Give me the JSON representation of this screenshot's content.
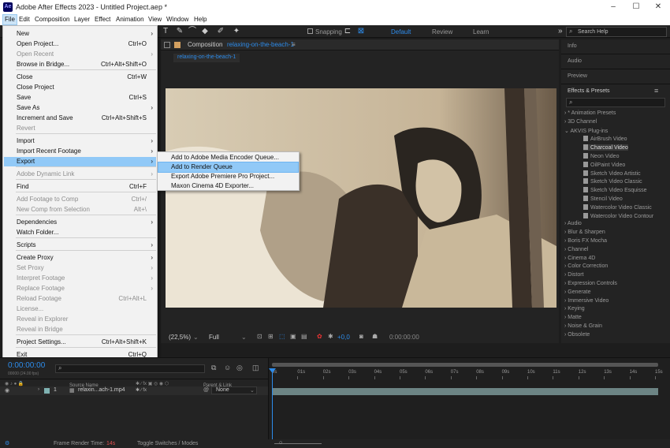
{
  "window": {
    "title": "Adobe After Effects 2023 - Untitled Project.aep *",
    "logo": "Ae",
    "minimize": "–",
    "maximize": "☐",
    "close": "✕"
  },
  "menubar": [
    "File",
    "Edit",
    "Composition",
    "Layer",
    "Effect",
    "Animation",
    "View",
    "Window",
    "Help"
  ],
  "toolbar": {
    "snapping": "Snapping",
    "workspaces": [
      "Default",
      "Review",
      "Learn"
    ],
    "more": "»",
    "search_placeholder": "Search Help"
  },
  "file_menu": [
    {
      "label": "New",
      "submenu": true
    },
    {
      "label": "Open Project...",
      "shortcut": "Ctrl+O"
    },
    {
      "label": "Open Recent",
      "disabled": true,
      "submenu": true
    },
    {
      "label": "Browse in Bridge...",
      "shortcut": "Ctrl+Alt+Shift+O"
    },
    {
      "label": "Close",
      "shortcut": "Ctrl+W"
    },
    {
      "label": "Close Project"
    },
    {
      "label": "Save",
      "shortcut": "Ctrl+S"
    },
    {
      "label": "Save As",
      "submenu": true
    },
    {
      "label": "Increment and Save",
      "shortcut": "Ctrl+Alt+Shift+S"
    },
    {
      "label": "Revert",
      "disabled": true
    },
    {
      "label": "Import",
      "submenu": true
    },
    {
      "label": "Import Recent Footage",
      "submenu": true
    },
    {
      "label": "Export",
      "submenu": true,
      "highlighted": true
    },
    {
      "label": "Adobe Dynamic Link",
      "disabled": true,
      "submenu": true
    },
    {
      "label": "Find",
      "shortcut": "Ctrl+F"
    },
    {
      "label": "Add Footage to Comp",
      "shortcut": "Ctrl+/",
      "disabled": true
    },
    {
      "label": "New Comp from Selection",
      "shortcut": "Alt+\\",
      "disabled": true
    },
    {
      "label": "Dependencies",
      "submenu": true
    },
    {
      "label": "Watch Folder..."
    },
    {
      "label": "Scripts",
      "submenu": true
    },
    {
      "label": "Create Proxy",
      "submenu": true
    },
    {
      "label": "Set Proxy",
      "disabled": true,
      "submenu": true
    },
    {
      "label": "Interpret Footage",
      "disabled": true,
      "submenu": true
    },
    {
      "label": "Replace Footage",
      "disabled": true,
      "submenu": true
    },
    {
      "label": "Reload Footage",
      "shortcut": "Ctrl+Alt+L",
      "disabled": true
    },
    {
      "label": "License...",
      "disabled": true
    },
    {
      "label": "Reveal in Explorer",
      "disabled": true
    },
    {
      "label": "Reveal in Bridge",
      "disabled": true
    },
    {
      "label": "Project Settings...",
      "shortcut": "Ctrl+Alt+Shift+K"
    },
    {
      "label": "Exit",
      "shortcut": "Ctrl+Q"
    }
  ],
  "export_submenu": [
    {
      "label": "Add to Adobe Media Encoder Queue..."
    },
    {
      "label": "Add to Render Queue",
      "highlighted": true
    },
    {
      "label": "Export Adobe Premiere Pro Project..."
    },
    {
      "label": "Maxon Cinema 4D Exporter..."
    }
  ],
  "composition": {
    "tab_label": "Composition",
    "comp_name": "relaxing-on-the-beach-1",
    "sub_tab": "relaxing-on-the-beach-1",
    "zoom": "(22,5%)",
    "resolution": "Full",
    "exposure": "+0,0",
    "timecode": "0:00:00:00"
  },
  "right_panel": {
    "tabs": [
      "Info",
      "Audio",
      "Preview"
    ],
    "effects_title": "Effects & Presets",
    "search_icon": "search-icon",
    "tree": [
      {
        "label": "* Animation Presets",
        "level": 0
      },
      {
        "label": "3D Channel",
        "level": 0
      },
      {
        "label": "AKVIS Plug-ins",
        "level": 0,
        "open": true
      },
      {
        "label": "AirBrush Video",
        "level": 1
      },
      {
        "label": "Charcoal Video",
        "level": 1,
        "selected": true
      },
      {
        "label": "Neon Video",
        "level": 1
      },
      {
        "label": "OilPaint Video",
        "level": 1
      },
      {
        "label": "Sketch Video Artistic",
        "level": 1
      },
      {
        "label": "Sketch Video Classic",
        "level": 1
      },
      {
        "label": "Sketch Video Esquisse",
        "level": 1
      },
      {
        "label": "Stencil Video",
        "level": 1
      },
      {
        "label": "Watercolor Video Classic",
        "level": 1
      },
      {
        "label": "Watercolor Video Contour",
        "level": 1
      },
      {
        "label": "Audio",
        "level": 0
      },
      {
        "label": "Blur & Sharpen",
        "level": 0
      },
      {
        "label": "Boris FX Mocha",
        "level": 0
      },
      {
        "label": "Channel",
        "level": 0
      },
      {
        "label": "Cinema 4D",
        "level": 0
      },
      {
        "label": "Color Correction",
        "level": 0
      },
      {
        "label": "Distort",
        "level": 0
      },
      {
        "label": "Expression Controls",
        "level": 0
      },
      {
        "label": "Generate",
        "level": 0
      },
      {
        "label": "Immersive Video",
        "level": 0
      },
      {
        "label": "Keying",
        "level": 0
      },
      {
        "label": "Matte",
        "level": 0
      },
      {
        "label": "Noise & Grain",
        "level": 0
      },
      {
        "label": "Obsolete",
        "level": 0
      }
    ]
  },
  "timeline": {
    "timecode": "0:00:00:00",
    "frame_info": "00000 (24.00 fps)",
    "col_source": "Source Name",
    "col_parent": "Parent & Link",
    "layer_num": "1",
    "layer_name": "relaxin...ach-1.mp4",
    "parent_value": "None",
    "ruler": [
      "0s",
      "01s",
      "02s",
      "03s",
      "04s",
      "05s",
      "06s",
      "07s",
      "08s",
      "09s",
      "10s",
      "11s",
      "12s",
      "13s",
      "14s",
      "15s"
    ]
  },
  "status": {
    "frame_render_label": "Frame Render Time:",
    "frame_render_value": "14s",
    "toggle": "Toggle Switches / Modes"
  },
  "colors": {
    "accent": "#2d8ceb",
    "highlight": "#91c9f7",
    "panel": "#232323"
  }
}
